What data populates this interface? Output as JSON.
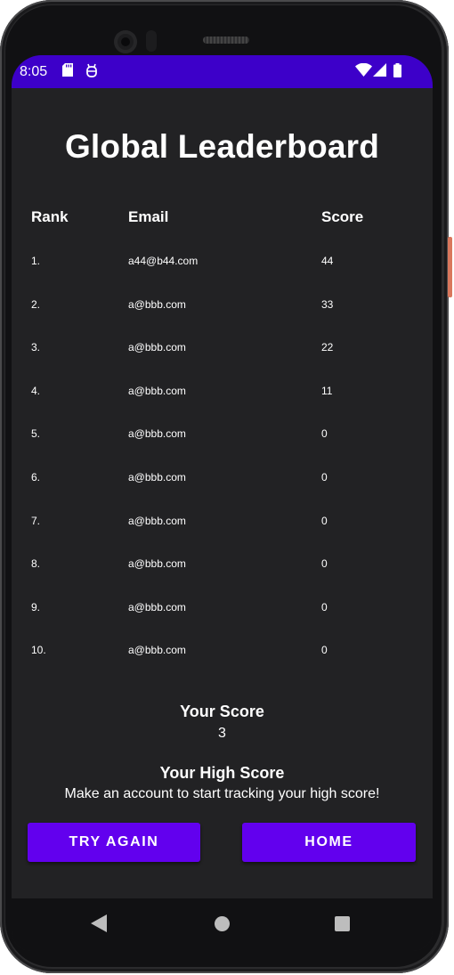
{
  "status_bar": {
    "time": "8:05",
    "bg_color": "#3d00c9",
    "icons": [
      "sd-card-icon",
      "app-notification-icon",
      "wifi-icon",
      "signal-icon",
      "battery-icon"
    ]
  },
  "leaderboard": {
    "title": "Global Leaderboard",
    "columns": {
      "rank": "Rank",
      "email": "Email",
      "score": "Score"
    },
    "rows": [
      {
        "rank": "1.",
        "email": "a44@b44.com",
        "score": "44"
      },
      {
        "rank": "2.",
        "email": "a@bbb.com",
        "score": "33"
      },
      {
        "rank": "3.",
        "email": "a@bbb.com",
        "score": "22"
      },
      {
        "rank": "4.",
        "email": "a@bbb.com",
        "score": "11"
      },
      {
        "rank": "5.",
        "email": "a@bbb.com",
        "score": "0"
      },
      {
        "rank": "6.",
        "email": "a@bbb.com",
        "score": "0"
      },
      {
        "rank": "7.",
        "email": "a@bbb.com",
        "score": "0"
      },
      {
        "rank": "8.",
        "email": "a@bbb.com",
        "score": "0"
      },
      {
        "rank": "9.",
        "email": "a@bbb.com",
        "score": "0"
      },
      {
        "rank": "10.",
        "email": "a@bbb.com",
        "score": "0"
      }
    ]
  },
  "your_score": {
    "label": "Your Score",
    "value": "3"
  },
  "high_score": {
    "label": "Your High Score",
    "message": "Make an account to start tracking your high score!"
  },
  "buttons": {
    "try_again": "TRY AGAIN",
    "home": "HOME"
  },
  "colors": {
    "accent": "#6200ee",
    "background": "#222224",
    "text": "#ffffff"
  },
  "nav_bar": {
    "icons": [
      "back-icon",
      "home-icon",
      "recents-icon"
    ]
  }
}
